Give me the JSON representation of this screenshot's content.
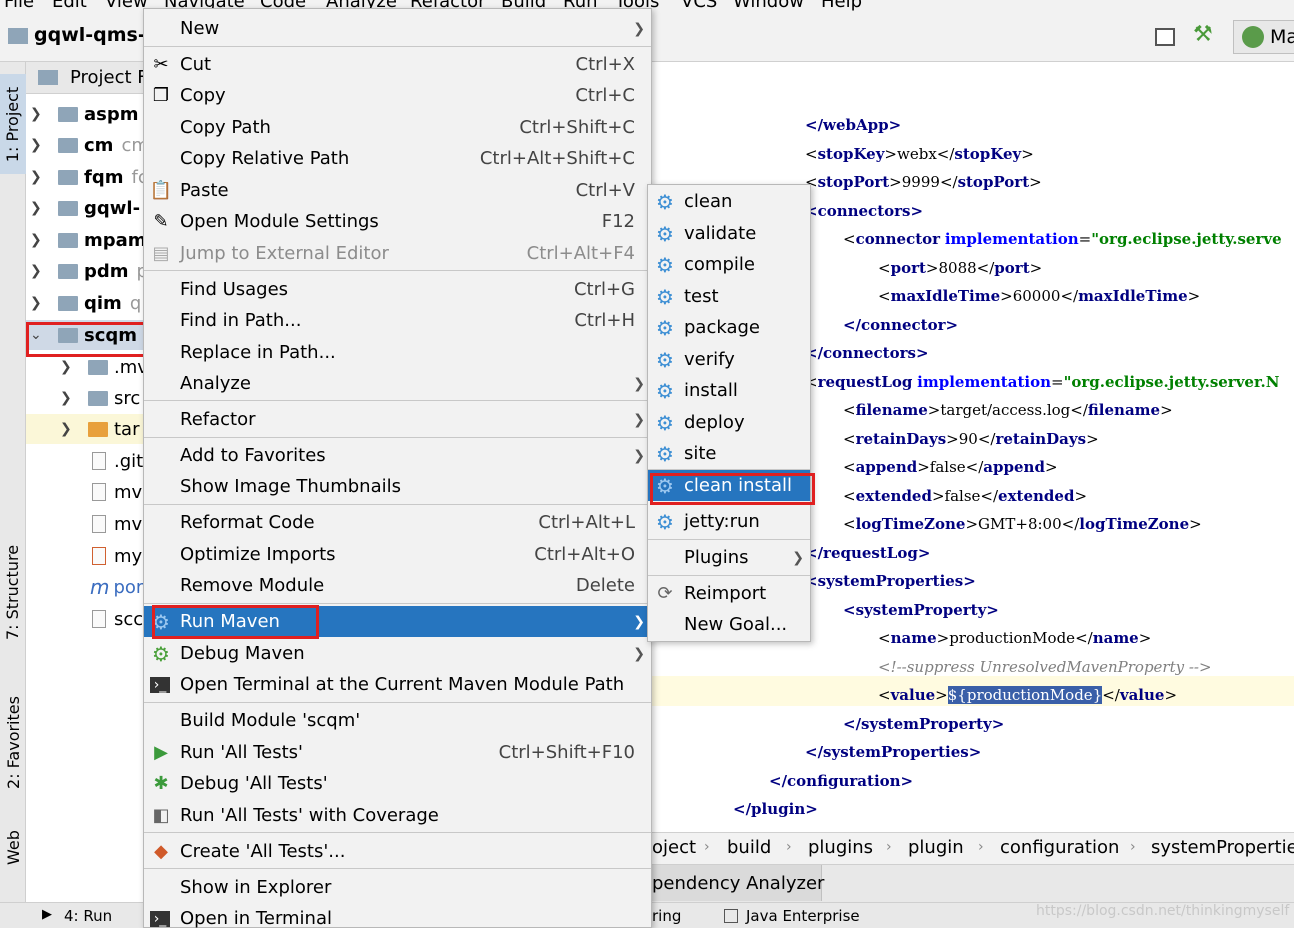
{
  "menubar": [
    "File",
    "Edit",
    "View",
    "Navigate",
    "Code",
    "Analyze",
    "Refactor",
    "Build",
    "Run",
    "Tools",
    "VCS",
    "Window",
    "Help"
  ],
  "toolbar": {
    "project_title": "gqwl-qms-E",
    "right_button": "Ma"
  },
  "leftstrip": {
    "project_tab": "1: Project",
    "structure_tab": "7: Structure",
    "favorites_tab": "2: Favorites",
    "web_tab": "Web"
  },
  "project_panel": {
    "header": "Project F",
    "modules": [
      {
        "name": "aspm",
        "suffix": ""
      },
      {
        "name": "cm",
        "suffix": "cm"
      },
      {
        "name": "fqm",
        "suffix": "fc"
      },
      {
        "name": "gqwl-",
        "suffix": ""
      },
      {
        "name": "mpam",
        "suffix": ""
      },
      {
        "name": "pdm",
        "suffix": "p"
      },
      {
        "name": "qim",
        "suffix": "q"
      },
      {
        "name": "scqm",
        "suffix": ""
      }
    ],
    "children": [
      ".mv",
      "src",
      "tar",
      ".git",
      "mv",
      "mv",
      "my",
      "por",
      "scc"
    ]
  },
  "context_menu": {
    "items": [
      {
        "label": "New",
        "shortcut": "",
        "submenu": true
      },
      {
        "label": "Cut",
        "shortcut": "Ctrl+X",
        "icon": "scissors-icon"
      },
      {
        "label": "Copy",
        "shortcut": "Ctrl+C",
        "icon": "copy-icon"
      },
      {
        "label": "Copy Path",
        "shortcut": "Ctrl+Shift+C"
      },
      {
        "label": "Copy Relative Path",
        "shortcut": "Ctrl+Alt+Shift+C"
      },
      {
        "label": "Paste",
        "shortcut": "Ctrl+V",
        "icon": "clipboard-icon"
      },
      {
        "label": "Open Module Settings",
        "shortcut": "F12",
        "icon": "pencil-icon"
      },
      {
        "label": "Jump to External Editor",
        "shortcut": "Ctrl+Alt+F4",
        "disabled": true
      },
      {
        "label": "Find Usages",
        "shortcut": "Ctrl+G"
      },
      {
        "label": "Find in Path...",
        "shortcut": "Ctrl+H"
      },
      {
        "label": "Replace in Path...",
        "shortcut": ""
      },
      {
        "label": "Analyze",
        "shortcut": "",
        "submenu": true
      },
      {
        "label": "Refactor",
        "shortcut": "",
        "submenu": true
      },
      {
        "label": "Add to Favorites",
        "shortcut": "",
        "submenu": true
      },
      {
        "label": "Show Image Thumbnails",
        "shortcut": ""
      },
      {
        "label": "Reformat Code",
        "shortcut": "Ctrl+Alt+L"
      },
      {
        "label": "Optimize Imports",
        "shortcut": "Ctrl+Alt+O"
      },
      {
        "label": "Remove Module",
        "shortcut": "Delete"
      },
      {
        "label": "Run Maven",
        "shortcut": "",
        "submenu": true,
        "selected": true
      },
      {
        "label": "Debug Maven",
        "shortcut": "",
        "submenu": true
      },
      {
        "label": "Open Terminal at the Current Maven Module Path",
        "shortcut": ""
      },
      {
        "label": "Build Module 'scqm'",
        "shortcut": ""
      },
      {
        "label": "Run 'All Tests'",
        "shortcut": "Ctrl+Shift+F10"
      },
      {
        "label": "Debug 'All Tests'",
        "shortcut": ""
      },
      {
        "label": "Run 'All Tests' with Coverage",
        "shortcut": ""
      },
      {
        "label": "Create 'All Tests'...",
        "shortcut": ""
      },
      {
        "label": "Show in Explorer",
        "shortcut": ""
      },
      {
        "label": "Open in Terminal",
        "shortcut": ""
      }
    ]
  },
  "submenu": {
    "items": [
      "clean",
      "validate",
      "compile",
      "test",
      "package",
      "verify",
      "install",
      "deploy",
      "site",
      "clean install",
      "jetty:run",
      "Plugins",
      "Reimport",
      "New Goal..."
    ],
    "selected": "clean install"
  },
  "editor": {
    "lines": [
      {
        "tag_open": "</webApp>"
      },
      {
        "tag": "stopKey",
        "value": "webx"
      },
      {
        "tag": "stopPort",
        "value": "9999"
      },
      {
        "tag_open": "<connectors>"
      },
      {
        "connector_attr": "implementation",
        "connector_val": "\"org.eclipse.jetty.serve"
      },
      {
        "tag": "port",
        "value": "8088"
      },
      {
        "tag": "maxIdleTime",
        "value": "60000"
      },
      {
        "tag_open": "</connector>"
      },
      {
        "tag_open": "</connectors>"
      },
      {
        "connector_attr": "implementation",
        "connector_val": "\"org.eclipse.jetty.server.N"
      },
      {
        "tag": "filename",
        "value": "target/access.log"
      },
      {
        "tag": "retainDays",
        "value": "90"
      },
      {
        "tag": "append",
        "value": "false"
      },
      {
        "tag": "extended",
        "value": "false"
      },
      {
        "tag": "logTimeZone",
        "value": "GMT+8:00"
      },
      {
        "tag_open": "</requestLog>"
      },
      {
        "tag_open": "<systemProperties>"
      },
      {
        "tag_open": "<systemProperty>"
      },
      {
        "tag": "name",
        "value": "productionMode"
      },
      {
        "comment": "<!--suppress UnresolvedMavenProperty -->"
      },
      {
        "tag": "value",
        "value": "${productionMode}"
      },
      {
        "tag_open": "</systemProperty>"
      },
      {
        "tag_open": "</systemProperties>"
      },
      {
        "tag_open": "</configuration>"
      },
      {
        "tag_open": "</plugin>"
      }
    ]
  },
  "breadcrumb": [
    "oject",
    "build",
    "plugins",
    "plugin",
    "configuration",
    "systemPropertie"
  ],
  "bottom_tabs": {
    "dependency_analyzer": "pendency Analyzer"
  },
  "statusbar": {
    "run_tab": "4: Run",
    "spring_tab": "ring",
    "java_ee_tab": "Java Enterprise",
    "watermark": "https://blog.csdn.net/thinkingmyself"
  }
}
